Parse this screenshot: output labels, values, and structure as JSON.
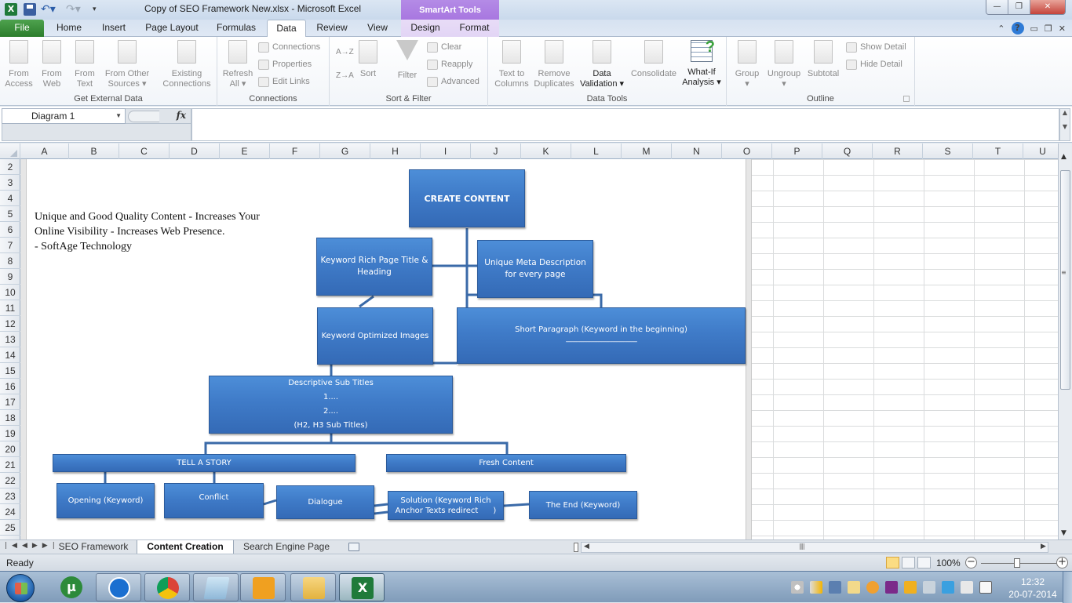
{
  "window": {
    "title": "Copy of SEO Framework New.xlsx  -  Microsoft Excel",
    "context_tab_group": "SmartArt Tools",
    "controls": {
      "minimize": "—",
      "restore": "❐",
      "close": "✕"
    }
  },
  "quick_access": {
    "app_icon": "excel-icon",
    "items": [
      "save-icon",
      "undo-icon",
      "redo-icon",
      "customize-dropdown-icon"
    ]
  },
  "tabs": [
    {
      "label": "File"
    },
    {
      "label": "Home"
    },
    {
      "label": "Insert"
    },
    {
      "label": "Page Layout"
    },
    {
      "label": "Formulas"
    },
    {
      "label": "Data",
      "active": true
    },
    {
      "label": "Review"
    },
    {
      "label": "View"
    },
    {
      "label": "Design",
      "context": true
    },
    {
      "label": "Format",
      "context": true
    }
  ],
  "tab_icons": {
    "collapse": "⌃",
    "help": "?",
    "minimize": "▭",
    "restore": "❐",
    "close": "✕"
  },
  "ribbon": {
    "groups": [
      {
        "label": "Get External Data",
        "buttons": [
          {
            "line1": "From",
            "line2": "Access"
          },
          {
            "line1": "From",
            "line2": "Web"
          },
          {
            "line1": "From",
            "line2": "Text"
          },
          {
            "line1": "From Other",
            "line2": "Sources ▾"
          },
          {
            "line1": "Existing",
            "line2": "Connections"
          }
        ]
      },
      {
        "label": "Connections",
        "buttons": [
          {
            "line1": "Refresh",
            "line2": "All ▾"
          }
        ],
        "small": [
          "Connections",
          "Properties",
          "Edit Links"
        ]
      },
      {
        "label": "Sort & Filter",
        "buttons": [
          {
            "line1": "Sort"
          },
          {
            "line1": "Filter"
          }
        ],
        "small": [
          "Clear",
          "Reapply",
          "Advanced"
        ],
        "sort_az": "A→Z",
        "sort_za": "Z→A"
      },
      {
        "label": "Data Tools",
        "buttons": [
          {
            "line1": "Text to",
            "line2": "Columns"
          },
          {
            "line1": "Remove",
            "line2": "Duplicates"
          },
          {
            "line1": "Data",
            "line2": "Validation ▾"
          },
          {
            "line1": "Consolidate"
          },
          {
            "line1": "What-If",
            "line2": "Analysis ▾"
          }
        ]
      },
      {
        "label": "Outline",
        "buttons": [
          {
            "line1": "Group",
            "line2": "▾"
          },
          {
            "line1": "Ungroup",
            "line2": "▾"
          },
          {
            "line1": "Subtotal"
          }
        ],
        "small": [
          "Show Detail",
          "Hide Detail"
        ]
      }
    ]
  },
  "formula_bar": {
    "name_box": "Diagram 1",
    "fx": "fx",
    "formula": ""
  },
  "columns": [
    "A",
    "B",
    "C",
    "D",
    "E",
    "F",
    "G",
    "H",
    "I",
    "J",
    "K",
    "L",
    "M",
    "N",
    "O",
    "P",
    "Q",
    "R",
    "S",
    "T",
    "U"
  ],
  "rows": [
    "2",
    "3",
    "4",
    "5",
    "6",
    "7",
    "8",
    "9",
    "10",
    "11",
    "12",
    "13",
    "14",
    "15",
    "16",
    "17",
    "18",
    "19",
    "20",
    "21",
    "22",
    "23",
    "24",
    "25"
  ],
  "quote": {
    "line1": "Unique and Good Quality Content - Increases Your",
    "line2": "Online Visibility - Increases Web Presence.",
    "line3": "- SoftAge  Technology"
  },
  "diagram": {
    "create_content": "CREATE  CONTENT",
    "keyword_title": "Keyword Rich Page Title & Heading",
    "meta_description": "Unique Meta Description for every page",
    "optimized_images": "Keyword Optimized Images",
    "short_paragraph": "Short Paragraph (Keyword in the beginning)",
    "short_paragraph_dashes": "------------------------------------------------",
    "subtitles": {
      "title": "Descriptive Sub Titles",
      "item1": "1....",
      "item2": "2....",
      "note": "(H2, H3 Sub Titles)"
    },
    "tell_a_story": "TELL A STORY",
    "fresh_content": "Fresh Content",
    "opening": "Opening (Keyword)",
    "conflict": "Conflict",
    "dialogue": "Dialogue",
    "solution_line1": "Solution (Keyword Rich",
    "solution_line2": "Anchor Texts redirect      )",
    "the_end": "The End  (Keyword)"
  },
  "sheet_tabs": [
    {
      "label": "SEO Framework"
    },
    {
      "label": "Content Creation",
      "active": true
    },
    {
      "label": "Search Engine Page"
    }
  ],
  "status": {
    "mode": "Ready",
    "zoom": "100%",
    "zoom_level_percent": 100,
    "view": "Normal"
  },
  "taskbar": {
    "apps": [
      "Windows Start",
      "uTorrent",
      "Maxthon",
      "Google Chrome",
      "Notepad",
      "Outlook",
      "Windows Explorer",
      "Microsoft Excel"
    ],
    "tray": [
      "network-icon",
      "signal-icon",
      "m-icon",
      "mail-icon",
      "messenger-icon",
      "onenote-icon",
      "outlook-icon",
      "volume-muted-icon",
      "update-icon",
      "action-center-icon",
      "power-icon"
    ],
    "time": "12:32",
    "date": "20-07-2014"
  },
  "colors": {
    "smartart_fill": "#3f7bc8",
    "smartart_border": "#2b5a9a",
    "file_tab": "#2c7d2c",
    "context_tab": "#a877e0"
  }
}
